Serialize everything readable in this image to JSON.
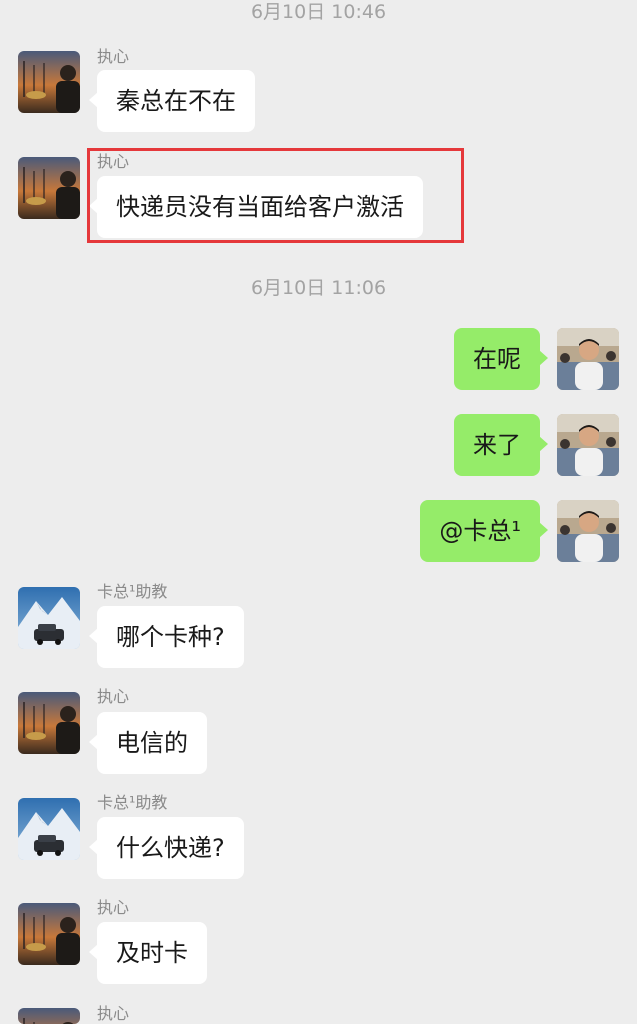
{
  "timestamps": [
    "6月10日 10:46",
    "6月10日 11:06"
  ],
  "colors": {
    "background": "#ededed",
    "incoming_bubble": "#ffffff",
    "outgoing_bubble": "#95ec69",
    "highlight_border": "#e5383b"
  },
  "messages": [
    {
      "direction": "incoming",
      "sender": "执心",
      "text": "秦总在不在",
      "avatar": "sunset-portrait-avatar"
    },
    {
      "direction": "incoming",
      "sender": "执心",
      "text": "快递员没有当面给客户激活",
      "avatar": "sunset-portrait-avatar",
      "highlighted": true
    },
    {
      "direction": "outgoing",
      "text": "在呢",
      "avatar": "classroom-portrait-avatar"
    },
    {
      "direction": "outgoing",
      "text": "来了",
      "avatar": "classroom-portrait-avatar"
    },
    {
      "direction": "outgoing",
      "text": "@卡总¹",
      "avatar": "classroom-portrait-avatar"
    },
    {
      "direction": "incoming",
      "sender": "卡总¹助教",
      "text": "哪个卡种?",
      "avatar": "snow-mountain-car-avatar"
    },
    {
      "direction": "incoming",
      "sender": "执心",
      "text": "电信的",
      "avatar": "sunset-portrait-avatar"
    },
    {
      "direction": "incoming",
      "sender": "卡总¹助教",
      "text": "什么快递?",
      "avatar": "snow-mountain-car-avatar"
    },
    {
      "direction": "incoming",
      "sender": "执心",
      "text": "及时卡",
      "avatar": "sunset-portrait-avatar"
    },
    {
      "direction": "incoming",
      "sender": "执心",
      "text": "",
      "avatar": "sunset-portrait-avatar"
    }
  ]
}
